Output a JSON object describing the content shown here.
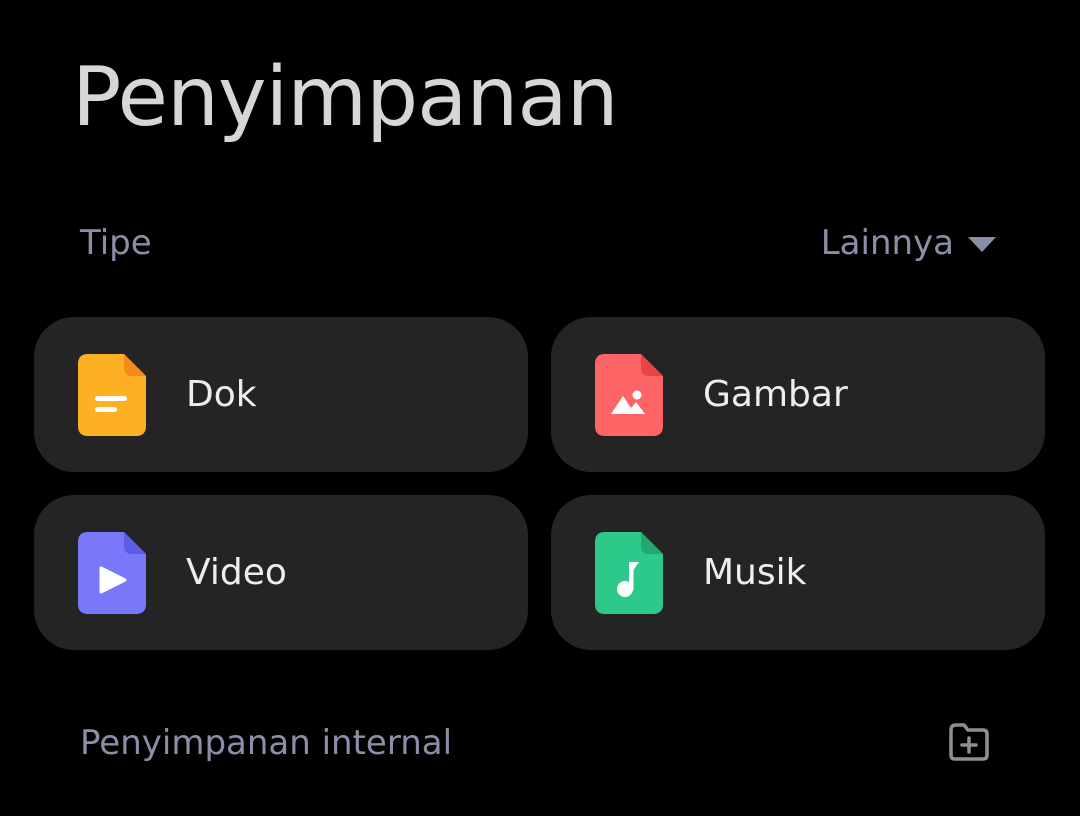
{
  "page": {
    "title": "Penyimpanan"
  },
  "types_section": {
    "label": "Tipe",
    "more": {
      "label": "Lainnya",
      "icon": "caret-down-icon"
    }
  },
  "categories": [
    {
      "label": "Dok",
      "icon": "document-file-icon",
      "color": "#FDB122"
    },
    {
      "label": "Gambar",
      "icon": "image-file-icon",
      "color": "#FD6466"
    },
    {
      "label": "Video",
      "icon": "video-file-icon",
      "color": "#7978FB"
    },
    {
      "label": "Musik",
      "icon": "music-file-icon",
      "color": "#2DC98A"
    }
  ],
  "internal_section": {
    "label": "Penyimpanan internal",
    "action_icon": "new-folder-icon"
  },
  "colors": {
    "background": "#000000",
    "card": "#242424",
    "muted_text": "#8a8fa8",
    "title_text": "#d6d6d6"
  }
}
